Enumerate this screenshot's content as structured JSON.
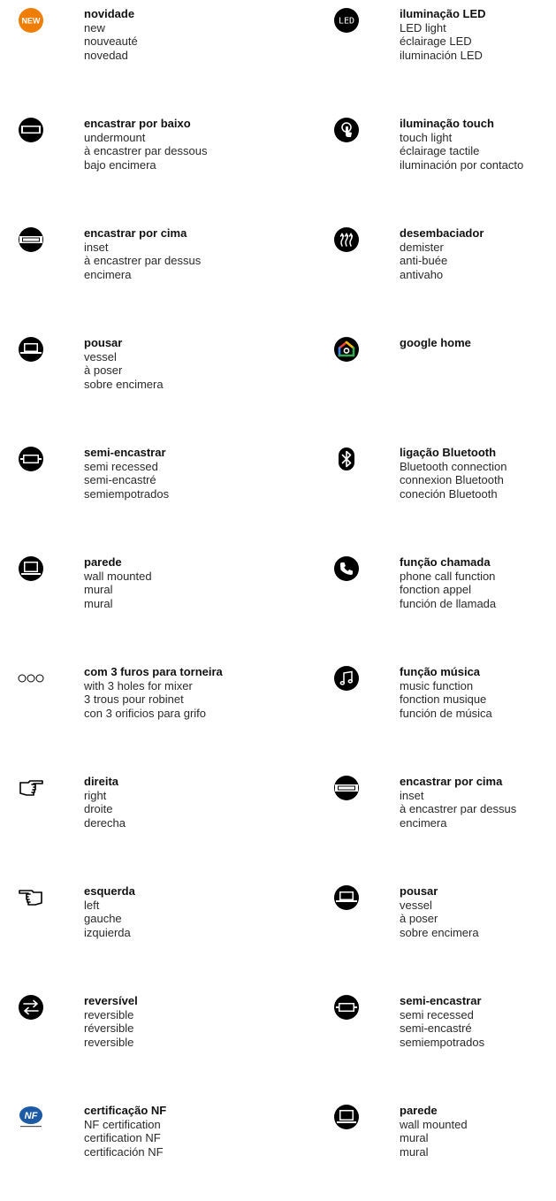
{
  "colors": {
    "text": "#1a1a1a",
    "icon": "#000000",
    "new_badge": "#ef7d00",
    "nf_blue": "#1d5aa6"
  },
  "left_column": [
    {
      "icon": "new-badge-icon",
      "badge_text": "NEW",
      "pt": "novidade",
      "en": "new",
      "fr": "nouveauté",
      "es": "novedad"
    },
    {
      "icon": "undermount-icon",
      "pt": "encastrar por baixo",
      "en": "undermount",
      "fr": "à encastrer par dessous",
      "es": "bajo encimera"
    },
    {
      "icon": "inset-icon",
      "pt": "encastrar por cima",
      "en": "inset",
      "fr": "à encastrer par dessus",
      "es": "encimera"
    },
    {
      "icon": "vessel-icon",
      "pt": "pousar",
      "en": "vessel",
      "fr": "à poser",
      "es": "sobre encimera"
    },
    {
      "icon": "semi-recessed-icon",
      "pt": "semi-encastrar",
      "en": "semi recessed",
      "fr": "semi-encastré",
      "es": "semiempotrados"
    },
    {
      "icon": "wall-mounted-icon",
      "pt": "parede",
      "en": "wall mounted",
      "fr": "mural",
      "es": "mural"
    },
    {
      "icon": "three-holes-icon",
      "pt": "com 3 furos para torneira",
      "en": "with 3 holes for mixer",
      "fr": "3 trous pour robinet",
      "es": "con 3 orificios para grifo"
    },
    {
      "icon": "hand-right-icon",
      "pt": "direita",
      "en": "right",
      "fr": "droite",
      "es": "derecha"
    },
    {
      "icon": "hand-left-icon",
      "pt": "esquerda",
      "en": "left",
      "fr": "gauche",
      "es": "izquierda"
    },
    {
      "icon": "reversible-icon",
      "pt": "reversível",
      "en": "reversible",
      "fr": "réversible",
      "es": "reversible"
    },
    {
      "icon": "nf-certification-icon",
      "badge_text": "NF",
      "pt": "certificação NF",
      "en": "NF certification",
      "fr": "certification NF",
      "es": "certificación NF"
    }
  ],
  "right_column": [
    {
      "icon": "led-icon",
      "badge_text": "LED",
      "pt": "iluminação LED",
      "en": "LED light",
      "fr": "éclairage LED",
      "es": "iluminación LED"
    },
    {
      "icon": "touch-light-icon",
      "pt": "iluminação touch",
      "en": "touch light",
      "fr": "éclairage tactile",
      "es": "iluminación por contacto"
    },
    {
      "icon": "demister-icon",
      "pt": "desembaciador",
      "en": "demister",
      "fr": "anti-buée",
      "es": "antivaho"
    },
    {
      "icon": "google-home-icon",
      "pt": "google home",
      "en": "",
      "fr": "",
      "es": ""
    },
    {
      "icon": "bluetooth-icon",
      "pt": "ligação Bluetooth",
      "en": "Bluetooth connection",
      "fr": "connexion Bluetooth",
      "es": "coneción Bluetooth"
    },
    {
      "icon": "phone-icon",
      "pt": "função chamada",
      "en": "phone call function",
      "fr": "fonction appel",
      "es": "función de llamada"
    },
    {
      "icon": "music-icon",
      "pt": "função música",
      "en": "music function",
      "fr": "fonction musique",
      "es": "función de música"
    },
    {
      "icon": "inset-icon",
      "pt": "encastrar por cima",
      "en": "inset",
      "fr": "à encastrer par dessus",
      "es": "encimera"
    },
    {
      "icon": "vessel-icon",
      "pt": "pousar",
      "en": "vessel",
      "fr": "à poser",
      "es": "sobre encimera"
    },
    {
      "icon": "semi-recessed-icon",
      "pt": "semi-encastrar",
      "en": "semi recessed",
      "fr": "semi-encastré",
      "es": "semiempotrados"
    },
    {
      "icon": "wall-mounted-icon",
      "pt": "parede",
      "en": "wall mounted",
      "fr": "mural",
      "es": "mural"
    }
  ]
}
